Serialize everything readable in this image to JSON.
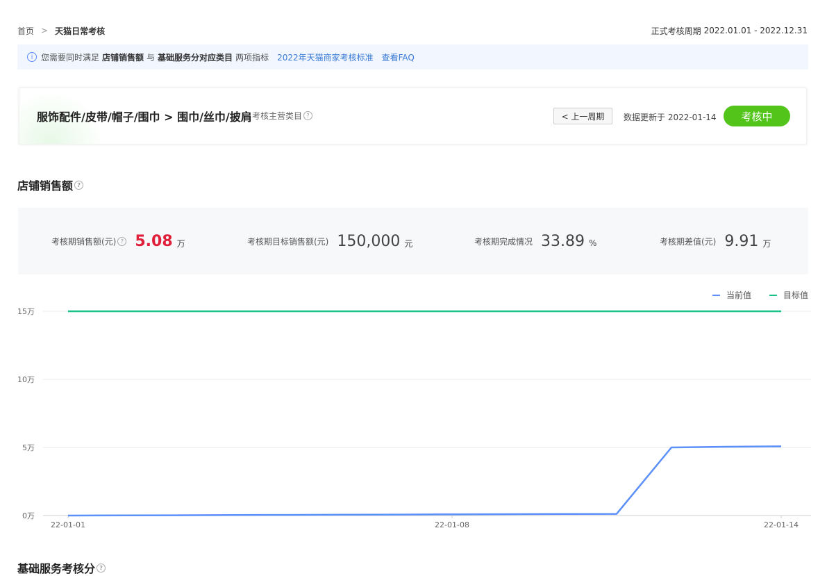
{
  "breadcrumb": {
    "home": "首页",
    "current": "天猫日常考核"
  },
  "period": {
    "label": "正式考核周期",
    "range": "2022.01.01 - 2022.12.31"
  },
  "notice": {
    "prefix": "您需要同时满足",
    "metric1": "店铺销售额",
    "joiner": "与",
    "metric2": "基础服务分对应类目",
    "suffix": "两项指标",
    "link_standard": "2022年天猫商家考核标准",
    "link_faq": "查看FAQ"
  },
  "category": {
    "path": "服饰配件/皮带/帽子/围巾 > 围巾/丝巾/披肩",
    "sub_label": "考核主营类目",
    "prev_button": "< 上一周期",
    "updated": "数据更新于 2022-01-14",
    "status": "考核中"
  },
  "sales_section": {
    "title": "店铺销售额"
  },
  "kpis": [
    {
      "label": "考核期销售额(元)",
      "value": "5.08",
      "unit": "万"
    },
    {
      "label": "考核期目标销售额(元)",
      "value": "150,000",
      "unit": "元"
    },
    {
      "label": "考核期完成情况",
      "value": "33.89",
      "unit": "%"
    },
    {
      "label": "考核期差值(元)",
      "value": "9.91",
      "unit": "万"
    }
  ],
  "chart_data": {
    "type": "line",
    "x": [
      "22-01-01",
      "22-01-02",
      "22-01-03",
      "22-01-04",
      "22-01-05",
      "22-01-06",
      "22-01-07",
      "22-01-08",
      "22-01-09",
      "22-01-10",
      "22-01-11",
      "22-01-12",
      "22-01-13",
      "22-01-14"
    ],
    "x_tick_labels": [
      "22-01-01",
      "22-01-08",
      "22-01-14"
    ],
    "y_tick_labels": [
      "0万",
      "5万",
      "10万",
      "15万"
    ],
    "y_ticks": [
      0,
      50000,
      100000,
      150000
    ],
    "ylim": [
      0,
      150000
    ],
    "series": [
      {
        "name": "当前值",
        "color": "#5b8ff9",
        "values": [
          0,
          100,
          200,
          350,
          450,
          600,
          700,
          900,
          1000,
          1100,
          1200,
          50000,
          50500,
          50800
        ]
      },
      {
        "name": "目标值",
        "color": "#19c28a",
        "values": [
          150000,
          150000,
          150000,
          150000,
          150000,
          150000,
          150000,
          150000,
          150000,
          150000,
          150000,
          150000,
          150000,
          150000
        ]
      }
    ],
    "grid": true,
    "legend": "top-right"
  },
  "service_section": {
    "title": "基础服务考核分"
  }
}
